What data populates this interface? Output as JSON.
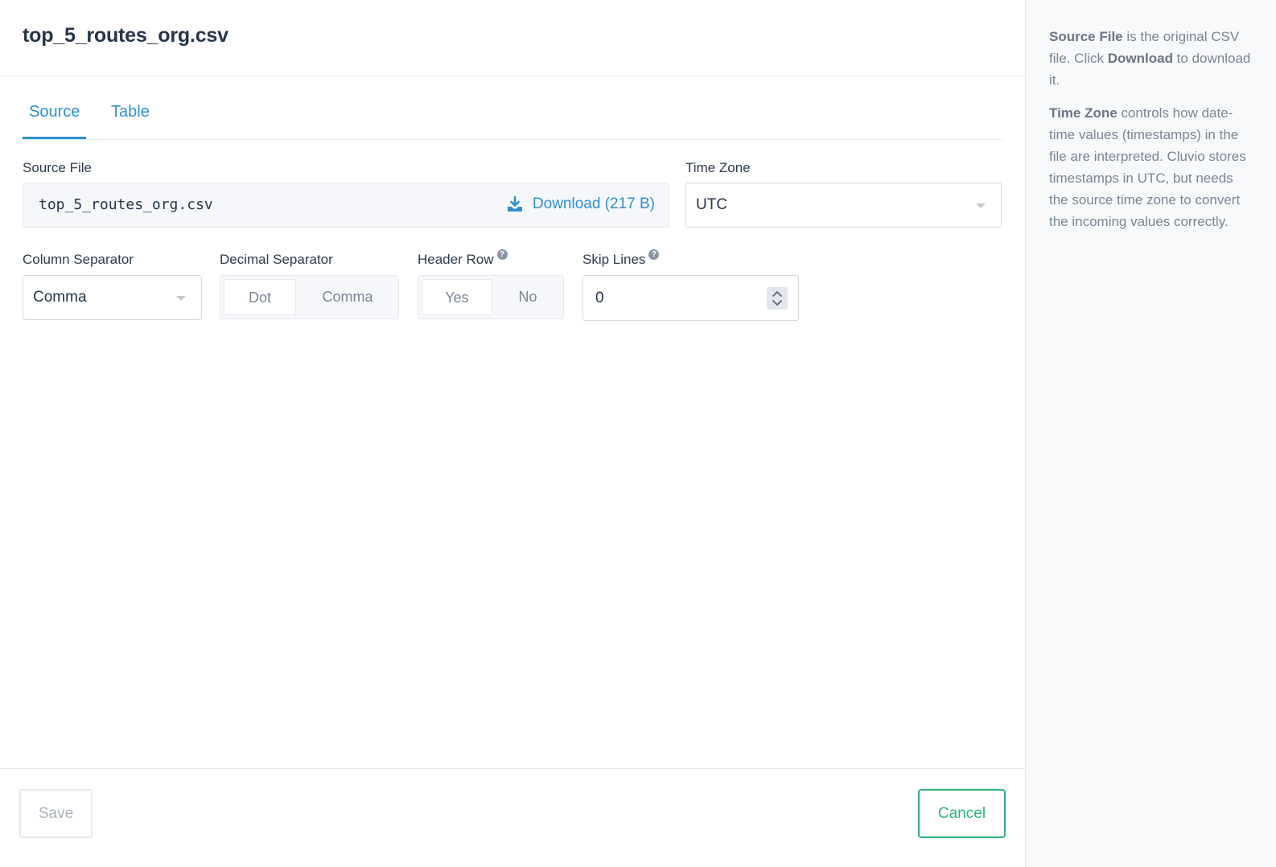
{
  "header": {
    "title": "top_5_routes_org.csv"
  },
  "tabs": [
    {
      "label": "Source",
      "active": true
    },
    {
      "label": "Table",
      "active": false
    }
  ],
  "source_file": {
    "label": "Source File",
    "filename": "top_5_routes_org.csv",
    "download_label": "Download (217 B)",
    "download_icon": "download-icon"
  },
  "time_zone": {
    "label": "Time Zone",
    "value": "UTC"
  },
  "column_separator": {
    "label": "Column Separator",
    "value": "Comma"
  },
  "decimal_separator": {
    "label": "Decimal Separator",
    "options": [
      "Dot",
      "Comma"
    ],
    "selected": "Dot"
  },
  "header_row": {
    "label": "Header Row",
    "help": "?",
    "options": [
      "Yes",
      "No"
    ],
    "selected": "Yes"
  },
  "skip_lines": {
    "label": "Skip Lines",
    "help": "?",
    "value": "0"
  },
  "footer": {
    "save_label": "Save",
    "cancel_label": "Cancel"
  },
  "help_panel": {
    "p1_bold1": "Source File",
    "p1_text1": " is the original CSV file. Click ",
    "p1_bold2": "Download",
    "p1_text2": " to download it.",
    "p2_bold1": "Time Zone",
    "p2_text1": " controls how date-time values (timestamps) in the file are interpreted. Cluvio stores timestamps in UTC, but needs the source time zone to convert the incoming values correctly."
  },
  "colors": {
    "accent_blue": "#2f8fd1",
    "accent_green": "#2fb37a",
    "text_dark": "#26354a",
    "text_muted": "#7a8594"
  }
}
